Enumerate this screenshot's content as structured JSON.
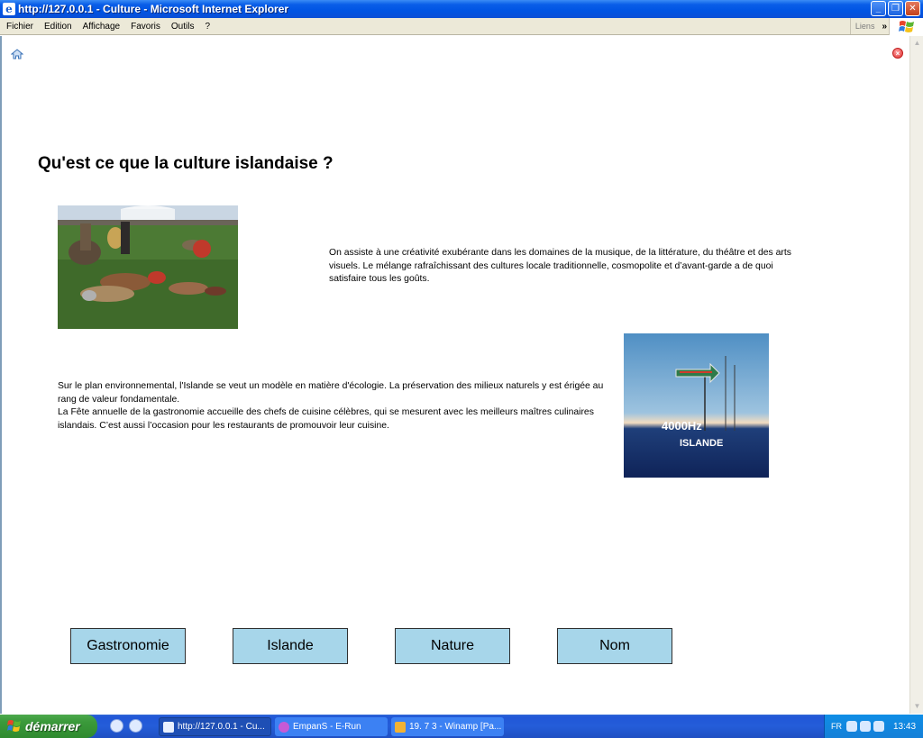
{
  "window": {
    "title": "http://127.0.0.1 - Culture - Microsoft Internet Explorer"
  },
  "menubar": {
    "items": [
      "Fichier",
      "Edition",
      "Affichage",
      "Favoris",
      "Outils",
      "?"
    ],
    "links_label": "Liens",
    "links_chevron": "»"
  },
  "page": {
    "heading": "Qu'est ce que la culture islandaise ?",
    "paragraph_right": "On assiste à une créativité exubérante dans les domaines de la musique, de la littérature, du théâtre et des arts visuels. Le mélange rafraîchissant des cultures locale traditionnelle, cosmopolite et d’avant-garde a de quoi satisfaire tous les goûts.",
    "paragraph_left_1": "Sur le plan environnemental, l'Islande se veut un modèle en matière d'écologie. La préservation des milieux naturels y est érigée au rang de valeur fondamentale.",
    "paragraph_left_2": "La Fête annuelle de la gastronomie accueille des chefs de cuisine célèbres, qui se mesurent avec les meilleurs maîtres culinaires islandais. C’est aussi l’occasion pour les restaurants de promouvoir leur cuisine.",
    "poster": {
      "big": "4000Hz",
      "small": "ISLANDE"
    },
    "buttons": [
      "Gastronomie",
      "Islande",
      "Nature",
      "Nom"
    ]
  },
  "taskbar": {
    "start_label": "démarrer",
    "tasks": [
      {
        "label": "http://127.0.0.1 - Cu..."
      },
      {
        "label": "EmpanS - E-Run"
      },
      {
        "label": "19. 7 3 - Winamp [Pa..."
      }
    ],
    "language": "FR",
    "clock": "13:43"
  },
  "colors": {
    "button_bg": "#a7d6ea",
    "titlebar": "#0054e3",
    "taskbar": "#245dd9",
    "start": "#3b9a3b"
  }
}
